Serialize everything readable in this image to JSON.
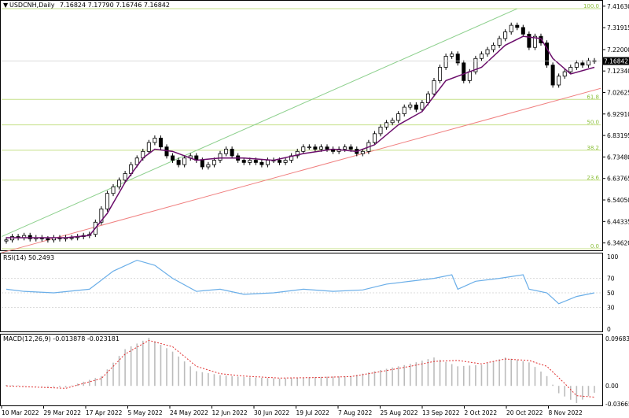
{
  "header": {
    "symbol_label": "USDCNH,Daily",
    "ohlc": "7.16824 7.17790 7.16746 7.16842"
  },
  "rsi": {
    "label": "RSI(14) 50.2493",
    "levels": [
      100,
      70,
      50,
      30,
      0
    ],
    "level_labels": [
      "100",
      "70",
      "50",
      "30",
      "0"
    ]
  },
  "macd": {
    "label": "MACD(12,26,9) -0.013878 -0.023181",
    "axis_labels": [
      "0.096831",
      "0.00",
      "-0.03665"
    ]
  },
  "price_axis": {
    "labels": [
      "7.41630",
      "7.31915",
      "7.22000",
      "7.12340",
      "7.02625",
      "6.92910",
      "6.83195",
      "6.73480",
      "6.63765",
      "6.54050",
      "6.44335",
      "6.34620"
    ],
    "current_price": "7.16842"
  },
  "fibonacci": {
    "levels": [
      {
        "label": "100.0",
        "price": 7.405
      },
      {
        "label": "61.8",
        "price": 6.995
      },
      {
        "label": "50.0",
        "price": 6.88
      },
      {
        "label": "38.2",
        "price": 6.765
      },
      {
        "label": "23.6",
        "price": 6.63
      },
      {
        "label": "0.0",
        "price": 6.32
      }
    ]
  },
  "x_axis": {
    "labels": [
      "10 Mar 2022",
      "29 Mar 2022",
      "17 Apr 2022",
      "5 May 2022",
      "24 May 2022",
      "12 Jun 2022",
      "30 Jun 2022",
      "19 Jul 2022",
      "7 Aug 2022",
      "25 Aug 2022",
      "13 Sep 2022",
      "2 Oct 2022",
      "20 Oct 2022",
      "8 Nov 2022"
    ]
  },
  "colors": {
    "bull_candle": "#ffffff",
    "bear_candle": "#000000",
    "ma_line": "#6b0d6b",
    "fib": "#c6e08a",
    "fib_text": "#8cbf3c",
    "channel_upper": "#8dd08d",
    "channel_lower": "#f08080",
    "rsi_line": "#6aaee8",
    "macd_signal": "#e03030",
    "macd_hist": "#bcbcbc",
    "price_tag": "#000000"
  },
  "chart_data": {
    "type": "candlestick",
    "title": "USDCNH,Daily",
    "ylim": [
      6.32,
      7.43
    ],
    "price_series": [
      [
        0,
        6.36
      ],
      [
        1,
        6.375
      ],
      [
        2,
        6.37
      ],
      [
        3,
        6.38
      ],
      [
        4,
        6.365
      ],
      [
        5,
        6.37
      ],
      [
        6,
        6.365
      ],
      [
        7,
        6.36
      ],
      [
        8,
        6.37
      ],
      [
        9,
        6.365
      ],
      [
        10,
        6.37
      ],
      [
        11,
        6.37
      ],
      [
        12,
        6.375
      ],
      [
        13,
        6.38
      ],
      [
        14,
        6.385
      ],
      [
        15,
        6.44
      ],
      [
        16,
        6.5
      ],
      [
        17,
        6.57
      ],
      [
        18,
        6.6
      ],
      [
        19,
        6.63
      ],
      [
        20,
        6.66
      ],
      [
        21,
        6.7
      ],
      [
        22,
        6.73
      ],
      [
        23,
        6.76
      ],
      [
        24,
        6.8
      ],
      [
        25,
        6.82
      ],
      [
        26,
        6.78
      ],
      [
        27,
        6.74
      ],
      [
        28,
        6.72
      ],
      [
        29,
        6.7
      ],
      [
        30,
        6.73
      ],
      [
        31,
        6.74
      ],
      [
        32,
        6.72
      ],
      [
        33,
        6.69
      ],
      [
        34,
        6.7
      ],
      [
        35,
        6.72
      ],
      [
        36,
        6.75
      ],
      [
        37,
        6.77
      ],
      [
        38,
        6.74
      ],
      [
        39,
        6.72
      ],
      [
        40,
        6.71
      ],
      [
        41,
        6.72
      ],
      [
        42,
        6.71
      ],
      [
        43,
        6.7
      ],
      [
        44,
        6.72
      ],
      [
        45,
        6.72
      ],
      [
        46,
        6.71
      ],
      [
        47,
        6.72
      ],
      [
        48,
        6.74
      ],
      [
        49,
        6.76
      ],
      [
        50,
        6.78
      ],
      [
        51,
        6.78
      ],
      [
        52,
        6.77
      ],
      [
        53,
        6.78
      ],
      [
        54,
        6.77
      ],
      [
        55,
        6.76
      ],
      [
        56,
        6.77
      ],
      [
        57,
        6.78
      ],
      [
        58,
        6.77
      ],
      [
        59,
        6.75
      ],
      [
        60,
        6.76
      ],
      [
        61,
        6.8
      ],
      [
        62,
        6.84
      ],
      [
        63,
        6.87
      ],
      [
        64,
        6.89
      ],
      [
        65,
        6.9
      ],
      [
        66,
        6.93
      ],
      [
        67,
        6.96
      ],
      [
        68,
        6.97
      ],
      [
        69,
        6.95
      ],
      [
        70,
        6.98
      ],
      [
        71,
        7.02
      ],
      [
        72,
        7.08
      ],
      [
        73,
        7.14
      ],
      [
        74,
        7.19
      ],
      [
        75,
        7.2
      ],
      [
        76,
        7.16
      ],
      [
        77,
        7.08
      ],
      [
        78,
        7.12
      ],
      [
        79,
        7.18
      ],
      [
        80,
        7.2
      ],
      [
        81,
        7.22
      ],
      [
        82,
        7.24
      ],
      [
        83,
        7.27
      ],
      [
        84,
        7.3
      ],
      [
        85,
        7.33
      ],
      [
        86,
        7.32
      ],
      [
        87,
        7.29
      ],
      [
        88,
        7.23
      ],
      [
        89,
        7.28
      ],
      [
        90,
        7.25
      ],
      [
        91,
        7.15
      ],
      [
        92,
        7.06
      ],
      [
        93,
        7.1
      ],
      [
        94,
        7.12
      ],
      [
        95,
        7.14
      ],
      [
        96,
        7.16
      ],
      [
        97,
        7.15
      ],
      [
        98,
        7.17
      ],
      [
        99,
        7.168
      ]
    ],
    "ma_series": [
      [
        0,
        6.37
      ],
      [
        10,
        6.37
      ],
      [
        14,
        6.38
      ],
      [
        17,
        6.48
      ],
      [
        20,
        6.62
      ],
      [
        23,
        6.73
      ],
      [
        25,
        6.77
      ],
      [
        28,
        6.76
      ],
      [
        32,
        6.72
      ],
      [
        36,
        6.73
      ],
      [
        40,
        6.73
      ],
      [
        45,
        6.72
      ],
      [
        50,
        6.75
      ],
      [
        55,
        6.77
      ],
      [
        59,
        6.76
      ],
      [
        62,
        6.79
      ],
      [
        66,
        6.88
      ],
      [
        70,
        6.94
      ],
      [
        74,
        7.08
      ],
      [
        77,
        7.11
      ],
      [
        80,
        7.14
      ],
      [
        84,
        7.24
      ],
      [
        87,
        7.28
      ],
      [
        90,
        7.27
      ],
      [
        92,
        7.18
      ],
      [
        95,
        7.11
      ],
      [
        99,
        7.14
      ]
    ],
    "rsi_series": [
      [
        0,
        55
      ],
      [
        3,
        52
      ],
      [
        8,
        50
      ],
      [
        14,
        55
      ],
      [
        18,
        80
      ],
      [
        22,
        95
      ],
      [
        25,
        88
      ],
      [
        28,
        70
      ],
      [
        32,
        52
      ],
      [
        36,
        55
      ],
      [
        40,
        48
      ],
      [
        45,
        50
      ],
      [
        50,
        55
      ],
      [
        55,
        52
      ],
      [
        60,
        54
      ],
      [
        64,
        62
      ],
      [
        68,
        66
      ],
      [
        72,
        70
      ],
      [
        75,
        75
      ],
      [
        76,
        55
      ],
      [
        79,
        66
      ],
      [
        83,
        70
      ],
      [
        87,
        75
      ],
      [
        88,
        55
      ],
      [
        91,
        50
      ],
      [
        93,
        35
      ],
      [
        96,
        45
      ],
      [
        99,
        50
      ]
    ],
    "macd_signal": [
      [
        0,
        0.0
      ],
      [
        10,
        -0.005
      ],
      [
        16,
        0.015
      ],
      [
        20,
        0.065
      ],
      [
        24,
        0.093
      ],
      [
        28,
        0.08
      ],
      [
        32,
        0.04
      ],
      [
        36,
        0.025
      ],
      [
        40,
        0.02
      ],
      [
        46,
        0.016
      ],
      [
        52,
        0.017
      ],
      [
        58,
        0.019
      ],
      [
        62,
        0.027
      ],
      [
        68,
        0.04
      ],
      [
        72,
        0.05
      ],
      [
        76,
        0.052
      ],
      [
        80,
        0.045
      ],
      [
        84,
        0.055
      ],
      [
        88,
        0.052
      ],
      [
        91,
        0.04
      ],
      [
        94,
        0.005
      ],
      [
        96,
        -0.02
      ],
      [
        99,
        -0.023
      ]
    ],
    "macd_hist": [
      [
        0,
        0.002
      ],
      [
        10,
        -0.003
      ],
      [
        16,
        0.02
      ],
      [
        20,
        0.075
      ],
      [
        24,
        0.098
      ],
      [
        28,
        0.07
      ],
      [
        32,
        0.03
      ],
      [
        36,
        0.022
      ],
      [
        40,
        0.018
      ],
      [
        46,
        0.015
      ],
      [
        52,
        0.018
      ],
      [
        58,
        0.02
      ],
      [
        62,
        0.03
      ],
      [
        68,
        0.045
      ],
      [
        72,
        0.058
      ],
      [
        76,
        0.04
      ],
      [
        80,
        0.043
      ],
      [
        84,
        0.058
      ],
      [
        88,
        0.048
      ],
      [
        91,
        0.02
      ],
      [
        93,
        -0.015
      ],
      [
        96,
        -0.035
      ],
      [
        99,
        -0.014
      ]
    ],
    "rsi_range": [
      0,
      100
    ],
    "macd_range": [
      -0.03665,
      0.096831
    ]
  }
}
